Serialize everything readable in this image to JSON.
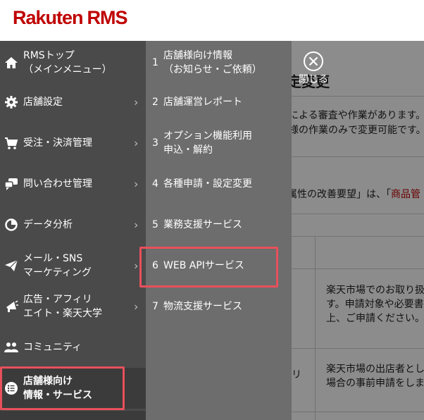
{
  "brand": {
    "logo_text": "Rakuten",
    "logo_suffix": "RMS",
    "accent": "#bf0000",
    "highlight": "#e8505b"
  },
  "menu": {
    "items": [
      {
        "label": "RMSトップ\n（メインメニュー）",
        "icon": "home-icon",
        "chevron": false
      },
      {
        "label": "店舗設定",
        "icon": "gear-icon",
        "chevron": true
      },
      {
        "label": "受注・決済管理",
        "icon": "cart-icon",
        "chevron": true
      },
      {
        "label": "問い合わせ管理",
        "icon": "chat-icon",
        "chevron": true
      },
      {
        "label": "データ分析",
        "icon": "pie-chart-icon",
        "chevron": true
      },
      {
        "label": "メール・SNS\nマーケティング",
        "icon": "paper-plane-icon",
        "chevron": true
      },
      {
        "label": "広告・アフィリ\nエイト・楽天大学",
        "icon": "megaphone-icon",
        "chevron": true
      },
      {
        "label": "コミュニティ",
        "icon": "people-icon",
        "chevron": false
      },
      {
        "label": "店舗様向け\n情報・サービス",
        "icon": "list-icon",
        "chevron": false
      }
    ]
  },
  "submenu": {
    "items": [
      {
        "num": "1",
        "label": "店舗様向け情報\n（お知らせ・ご依頼）"
      },
      {
        "num": "2",
        "label": "店舗運営レポート"
      },
      {
        "num": "3",
        "label": "オプション機能利用\n申込・解約"
      },
      {
        "num": "4",
        "label": "各種申請・設定変更"
      },
      {
        "num": "5",
        "label": "業務支援サービス"
      },
      {
        "num": "6",
        "label": "WEB APIサービス"
      },
      {
        "num": "7",
        "label": "物流支援サービス"
      }
    ]
  },
  "close": {
    "label": "閉じる",
    "icon": "close-circle-icon"
  },
  "background": {
    "title": "定変更",
    "line1": "による審査や作業があります。",
    "line2": "様の作業のみで変更可能です。",
    "line3_prefix": "属性の改善要望」は、「",
    "line3_link": "商品管",
    "cell1_line1": "楽天市場でのお取り扱",
    "cell1_line2": "す。申請対象や必要書",
    "cell1_line3": "上、ご申請ください。",
    "cell2_label": "リ",
    "cell2_line1": "楽天市場の出店者とし",
    "cell2_line2": "場合の事前申請をしま"
  }
}
